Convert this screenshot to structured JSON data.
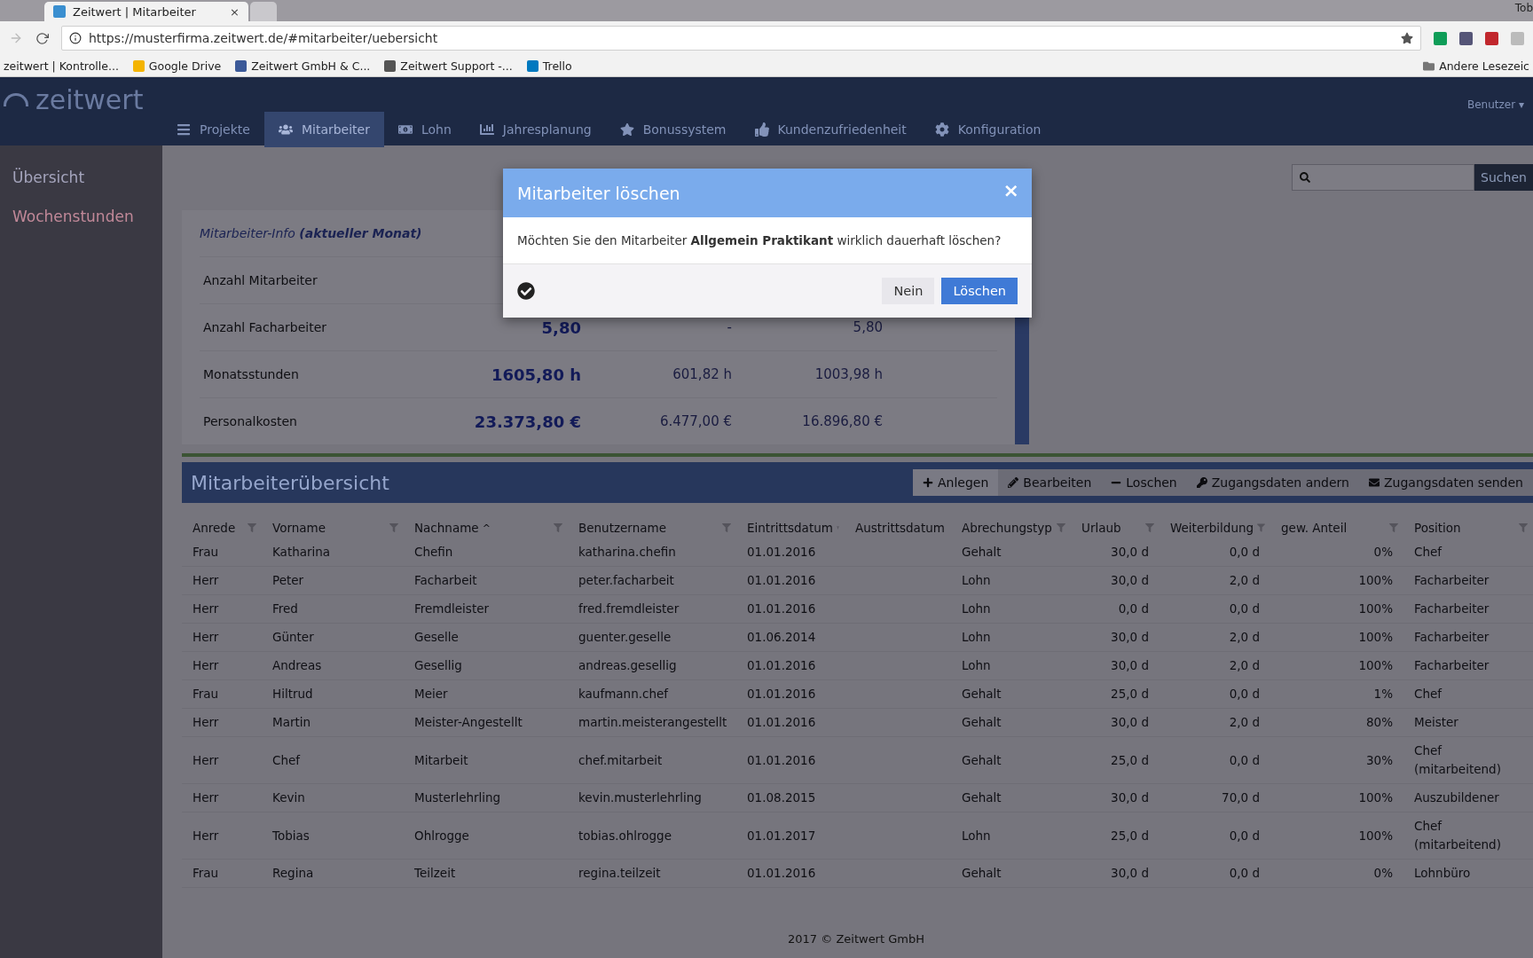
{
  "browser": {
    "tabs": [
      {
        "title": "Zeitwert | Mitarbeiter",
        "close": "×",
        "selected": true
      },
      {
        "selected": false
      }
    ],
    "profile": "Tob",
    "url": "https://musterfirma.zeitwert.de/#mitarbeiter/uebersicht",
    "bookmarks": [
      "zeitwert | Kontrolle...",
      "Google Drive",
      "Zeitwert GmbH & C...",
      "Zeitwert Support -...",
      "Trello"
    ],
    "other_bookmarks": "Andere Lesezeic"
  },
  "app": {
    "logo": "zeitwert",
    "nav": [
      {
        "label": "Projekte",
        "selected": false
      },
      {
        "label": "Mitarbeiter",
        "selected": true
      },
      {
        "label": "Lohn",
        "selected": false
      },
      {
        "label": "Jahresplanung",
        "selected": false
      },
      {
        "label": "Bonussystem",
        "selected": false
      },
      {
        "label": "Kundenzufriedenheit",
        "selected": false
      },
      {
        "label": "Konfiguration",
        "selected": false
      }
    ],
    "user_menu": {
      "label": "Benutzer",
      "caret": "▾"
    },
    "sidebar": [
      {
        "label": "Übersicht",
        "selected": true
      },
      {
        "label": "Wochenstunden",
        "selected": false
      }
    ],
    "search": {
      "button": "Suchen"
    },
    "info": {
      "title": "Mitarbeiter-Info **(aktueller Monat)**",
      "rows": [
        {
          "label": "Anzahl Mitarbeiter",
          "values": []
        },
        {
          "label": "Anzahl Facharbeiter",
          "values": [
            "5,80",
            "-",
            "5,80"
          ]
        },
        {
          "label": "Monatsstunden",
          "values": [
            "1605,80 h",
            "601,82 h",
            "1003,98 h"
          ]
        },
        {
          "label": "Personalkosten",
          "values": [
            "23.373,80 €",
            "6.477,00 €",
            "16.896,80 €"
          ]
        }
      ]
    },
    "overview": {
      "title": "Mitarbeiterübersicht",
      "actions": [
        "Anlegen",
        "Bearbeiten",
        "Loschen",
        "Zugangsdaten andern",
        "Zugangsdaten senden"
      ],
      "columns": [
        {
          "label": "Anrede"
        },
        {
          "label": "Vorname"
        },
        {
          "label": "Nachname",
          "sort_mark": "^"
        },
        {
          "label": "Benutzername"
        },
        {
          "label": "Eintrittsdatum"
        },
        {
          "label": "Austrittsdatum"
        },
        {
          "label": "Abrechungstyp"
        },
        {
          "label": "Urlaub"
        },
        {
          "label": "Weiterbildung"
        },
        {
          "label": "gew. Anteil"
        },
        {
          "label": "Position"
        }
      ],
      "rows": [
        [
          "Frau",
          "Katharina",
          "Chefin",
          "katharina.chefin",
          "01.01.2016",
          null,
          "Gehalt",
          "30,0 d",
          "0,0 d",
          "0%",
          "Chef"
        ],
        [
          "Herr",
          "Peter",
          "Facharbeit",
          "peter.facharbeit",
          "01.01.2016",
          null,
          "Lohn",
          "30,0 d",
          "2,0 d",
          "100%",
          "Facharbeiter"
        ],
        [
          "Herr",
          "Fred",
          "Fremdleister",
          "fred.fremdleister",
          "01.01.2016",
          null,
          "Lohn",
          "0,0 d",
          "0,0 d",
          "100%",
          "Facharbeiter"
        ],
        [
          "Herr",
          "Günter",
          "Geselle",
          "guenter.geselle",
          "01.06.2014",
          null,
          "Lohn",
          "30,0 d",
          "2,0 d",
          "100%",
          "Facharbeiter"
        ],
        [
          "Herr",
          "Andreas",
          "Gesellig",
          "andreas.gesellig",
          "01.01.2016",
          null,
          "Lohn",
          "30,0 d",
          "2,0 d",
          "100%",
          "Facharbeiter"
        ],
        [
          "Frau",
          "Hiltrud",
          "Meier",
          "kaufmann.chef",
          "01.01.2016",
          null,
          "Gehalt",
          "25,0 d",
          "0,0 d",
          "1%",
          "Chef"
        ],
        [
          "Herr",
          "Martin",
          "Meister-Angestellt",
          "martin.meisterangestellt",
          "01.01.2016",
          null,
          "Gehalt",
          "30,0 d",
          "2,0 d",
          "80%",
          "Meister"
        ],
        [
          "Herr",
          "Chef",
          "Mitarbeit",
          "chef.mitarbeit",
          "01.01.2016",
          null,
          "Gehalt",
          "25,0 d",
          "0,0 d",
          "30%",
          "Chef (mitarbeitend)"
        ],
        [
          "Herr",
          "Kevin",
          "Musterlehrling",
          "kevin.musterlehrling",
          "01.08.2015",
          null,
          "Gehalt",
          "30,0 d",
          "70,0 d",
          "100%",
          "Auszubildener"
        ],
        [
          "Herr",
          "Tobias",
          "Ohlrogge",
          "tobias.ohlrogge",
          "01.01.2017",
          null,
          "Lohn",
          "25,0 d",
          "0,0 d",
          "100%",
          "Chef (mitarbeitend)"
        ],
        [
          "Frau",
          "Regina",
          "Teilzeit",
          "regina.teilzeit",
          "01.01.2016",
          null,
          "Gehalt",
          "30,0 d",
          "0,0 d",
          "0%",
          "Lohnbüro"
        ]
      ]
    },
    "footer": "2017 © Zeitwert GmbH"
  },
  "dialog": {
    "title": "Mitarbeiter löschen",
    "close": "×",
    "message": "Möchten Sie den Mitarbeiter **Allgemein Praktikant** wirklich dauerhaft löschen?",
    "buttons": [
      {
        "label": "Nein",
        "kind": "default"
      },
      {
        "label": "Löschen",
        "kind": "primary"
      }
    ]
  }
}
